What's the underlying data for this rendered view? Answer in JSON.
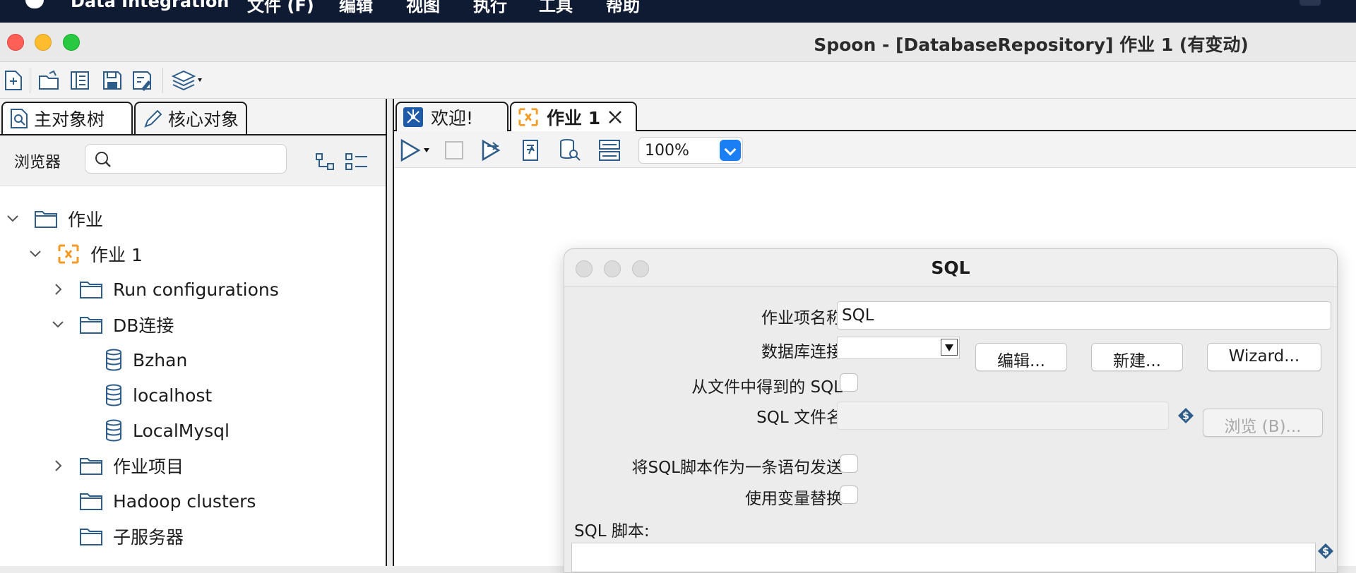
{
  "menubar": {
    "app_name": "Data Integration",
    "items": [
      "文件 (F)",
      "编辑",
      "视图",
      "执行",
      "工具",
      "帮助"
    ]
  },
  "window": {
    "title": "Spoon - [DatabaseRepository] 作业 1 (有变动)"
  },
  "left_panel": {
    "tabs": [
      {
        "label": "主对象树",
        "icon": "object-tree-icon",
        "active": true
      },
      {
        "label": "核心对象",
        "icon": "pencil-icon",
        "active": false
      }
    ],
    "browse_label": "浏览器",
    "search_placeholder": "",
    "tree": [
      {
        "label": "作业",
        "icon": "folder-icon",
        "expanded": true,
        "level": 0
      },
      {
        "label": "作业 1",
        "icon": "job-icon",
        "expanded": true,
        "level": 1
      },
      {
        "label": "Run configurations",
        "icon": "folder-icon",
        "expanded": false,
        "level": 2
      },
      {
        "label": "DB连接",
        "icon": "folder-icon",
        "expanded": true,
        "level": 2
      },
      {
        "label": "Bzhan",
        "icon": "database-icon",
        "level": 3
      },
      {
        "label": "localhost",
        "icon": "database-icon",
        "level": 3
      },
      {
        "label": "LocalMysql",
        "icon": "database-icon",
        "level": 3
      },
      {
        "label": "作业项目",
        "icon": "folder-icon",
        "expanded": false,
        "level": 2
      },
      {
        "label": "Hadoop clusters",
        "icon": "folder-icon",
        "level": 2
      },
      {
        "label": "子服务器",
        "icon": "folder-icon",
        "level": 2
      }
    ]
  },
  "editor": {
    "tabs": [
      {
        "label": "欢迎!",
        "icon": "welcome-icon",
        "active": false
      },
      {
        "label": "作业 1",
        "icon": "job-icon",
        "active": true,
        "closable": true
      }
    ],
    "zoom": "100%"
  },
  "sql_dialog": {
    "title": "SQL",
    "job_entry_name_label": "作业项名称",
    "job_entry_name_value": "SQL",
    "db_connection_label": "数据库连接",
    "db_connection_value": "",
    "edit_button": "编辑...",
    "new_button": "新建...",
    "wizard_button": "Wizard...",
    "sql_from_file_label": "从文件中得到的 SQL",
    "sql_filename_label": "SQL 文件名",
    "browse_button": "浏览 (B)...",
    "send_as_single_label": "将SQL脚本作为一条语句发送",
    "variable_substitution_label": "使用变量替换",
    "sql_script_label": "SQL 脚本:"
  },
  "colors": {
    "accent_blue": "#1a7ff5",
    "job_orange": "#f39b25",
    "menubar_bg": "#0f1a33",
    "variable_icon": "#2f5d8a"
  }
}
